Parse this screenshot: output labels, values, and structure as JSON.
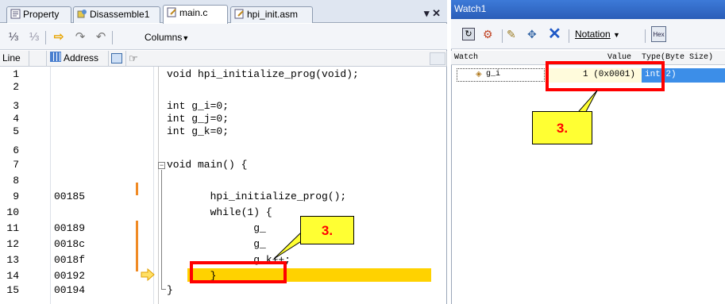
{
  "editor": {
    "tabs": [
      {
        "label": "Property"
      },
      {
        "label": "Disassemble1"
      },
      {
        "label": "main.c"
      },
      {
        "label": "hpi_init.asm"
      }
    ],
    "tab_controls": "▾ ✕",
    "columns_label": "Columns",
    "column_headers": {
      "line": "Line",
      "address": "Address"
    },
    "lines": [
      {
        "num": "1",
        "addr": "",
        "code": "void hpi_initialize_prog(void);"
      },
      {
        "num": "2",
        "addr": "",
        "code": ""
      },
      {
        "num": "3",
        "addr": "",
        "code": "int g_i=0;"
      },
      {
        "num": "4",
        "addr": "",
        "code": "int g_j=0;"
      },
      {
        "num": "5",
        "addr": "",
        "code": "int g_k=0;"
      },
      {
        "num": "6",
        "addr": "",
        "code": ""
      },
      {
        "num": "7",
        "addr": "",
        "code": "void main() {"
      },
      {
        "num": "8",
        "addr": "",
        "code": ""
      },
      {
        "num": "9",
        "addr": "00185",
        "code": "       hpi_initialize_prog();"
      },
      {
        "num": "10",
        "addr": "",
        "code": "       while(1) {"
      },
      {
        "num": "11",
        "addr": "00189",
        "code": "              g_"
      },
      {
        "num": "12",
        "addr": "0018c",
        "code": "              g_"
      },
      {
        "num": "13",
        "addr": "0018f",
        "code": "              g_k++;"
      },
      {
        "num": "14",
        "addr": "00192",
        "code": "       }"
      },
      {
        "num": "15",
        "addr": "00194",
        "code": "}"
      }
    ],
    "callout": "3."
  },
  "watch": {
    "title": "Watch1",
    "notation_label": "Notation",
    "hex_label": "Hex",
    "headers": {
      "watch": "Watch",
      "value": "Value",
      "type": "Type(Byte Size)"
    },
    "row": {
      "name": "g_i",
      "value": "1 (0x0001)",
      "type": "int 2)"
    },
    "callout": "3."
  }
}
